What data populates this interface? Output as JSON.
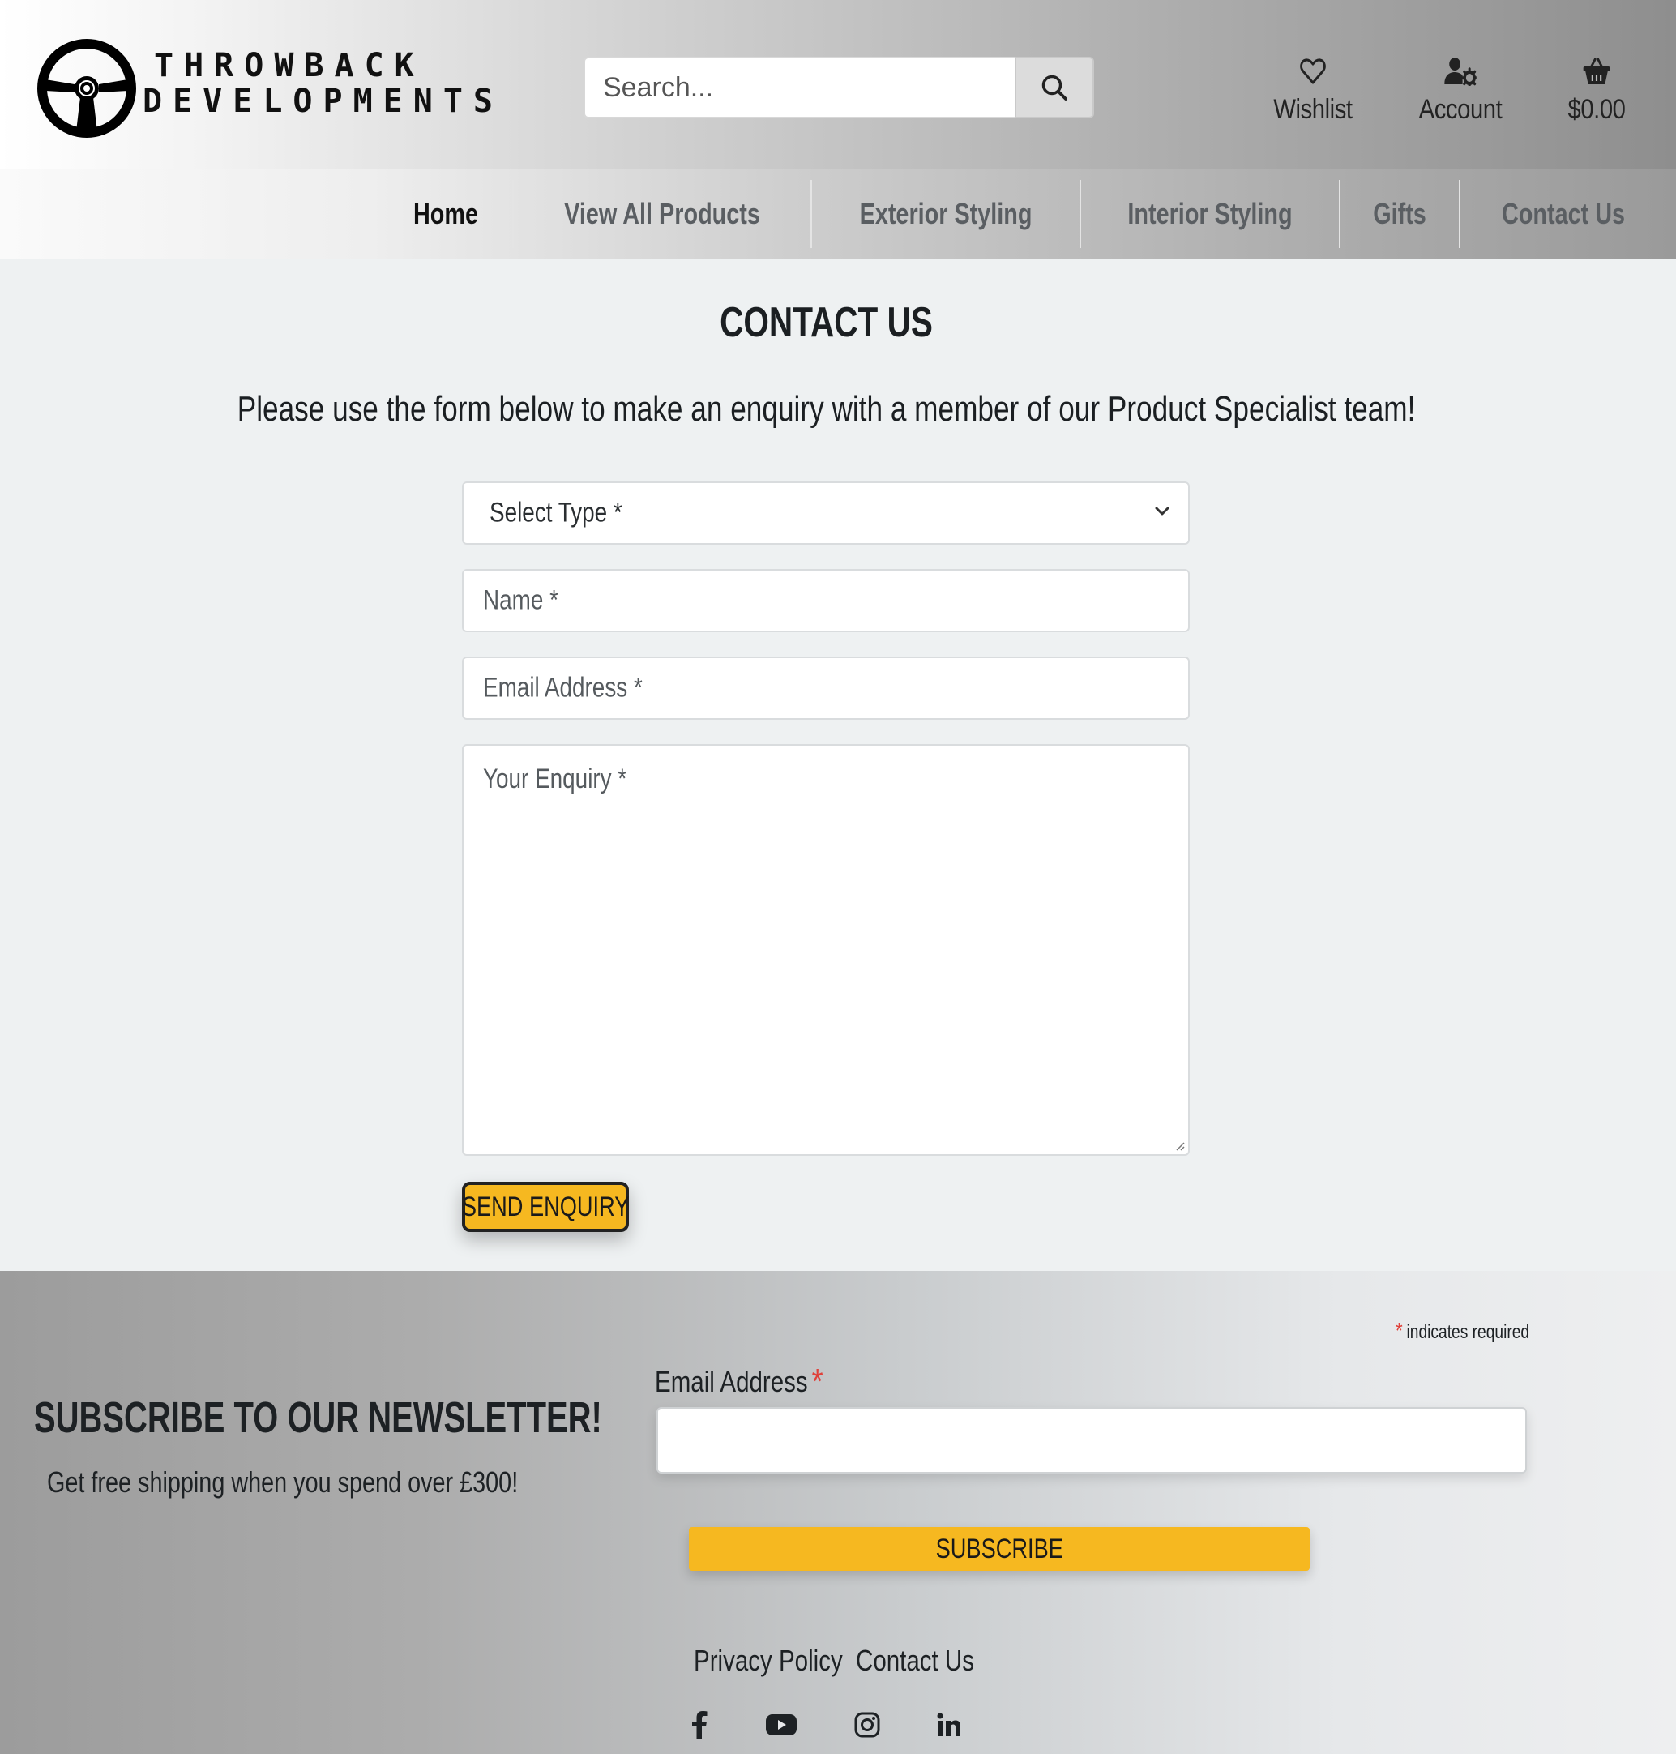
{
  "header": {
    "logo": {
      "line1": "THROWBACK",
      "line2": "DEVELOPMENTS"
    },
    "search": {
      "placeholder": "Search..."
    },
    "wishlist_label": "Wishlist",
    "account_label": "Account",
    "cart_total": "$0.00"
  },
  "nav": {
    "items": [
      {
        "label": "Home"
      },
      {
        "label": "View All Products"
      },
      {
        "label": "Exterior Styling"
      },
      {
        "label": "Interior Styling"
      },
      {
        "label": "Gifts"
      },
      {
        "label": "Contact Us"
      }
    ]
  },
  "main": {
    "title": "CONTACT US",
    "intro": "Please use the form below to make an enquiry with a member of our Product Specialist team!",
    "form": {
      "type_select": "Select Type *",
      "name_placeholder": "Name *",
      "email_placeholder": "Email Address *",
      "enquiry_placeholder": "Your Enquiry *",
      "submit_label": "SEND ENQUIRY"
    }
  },
  "footer": {
    "newsletter_title": "SUBSCRIBE TO OUR NEWSLETTER!",
    "newsletter_sub": "Get free shipping when you spend over £300!",
    "required_note": "indicates required",
    "required_star": "*",
    "email_label": "Email Address",
    "subscribe_label": "SUBSCRIBE",
    "links": {
      "privacy": "Privacy Policy",
      "contact": "Contact Us"
    }
  },
  "colors": {
    "accent": "#f6b820",
    "required": "#e0413a",
    "text": "#1d2124"
  }
}
